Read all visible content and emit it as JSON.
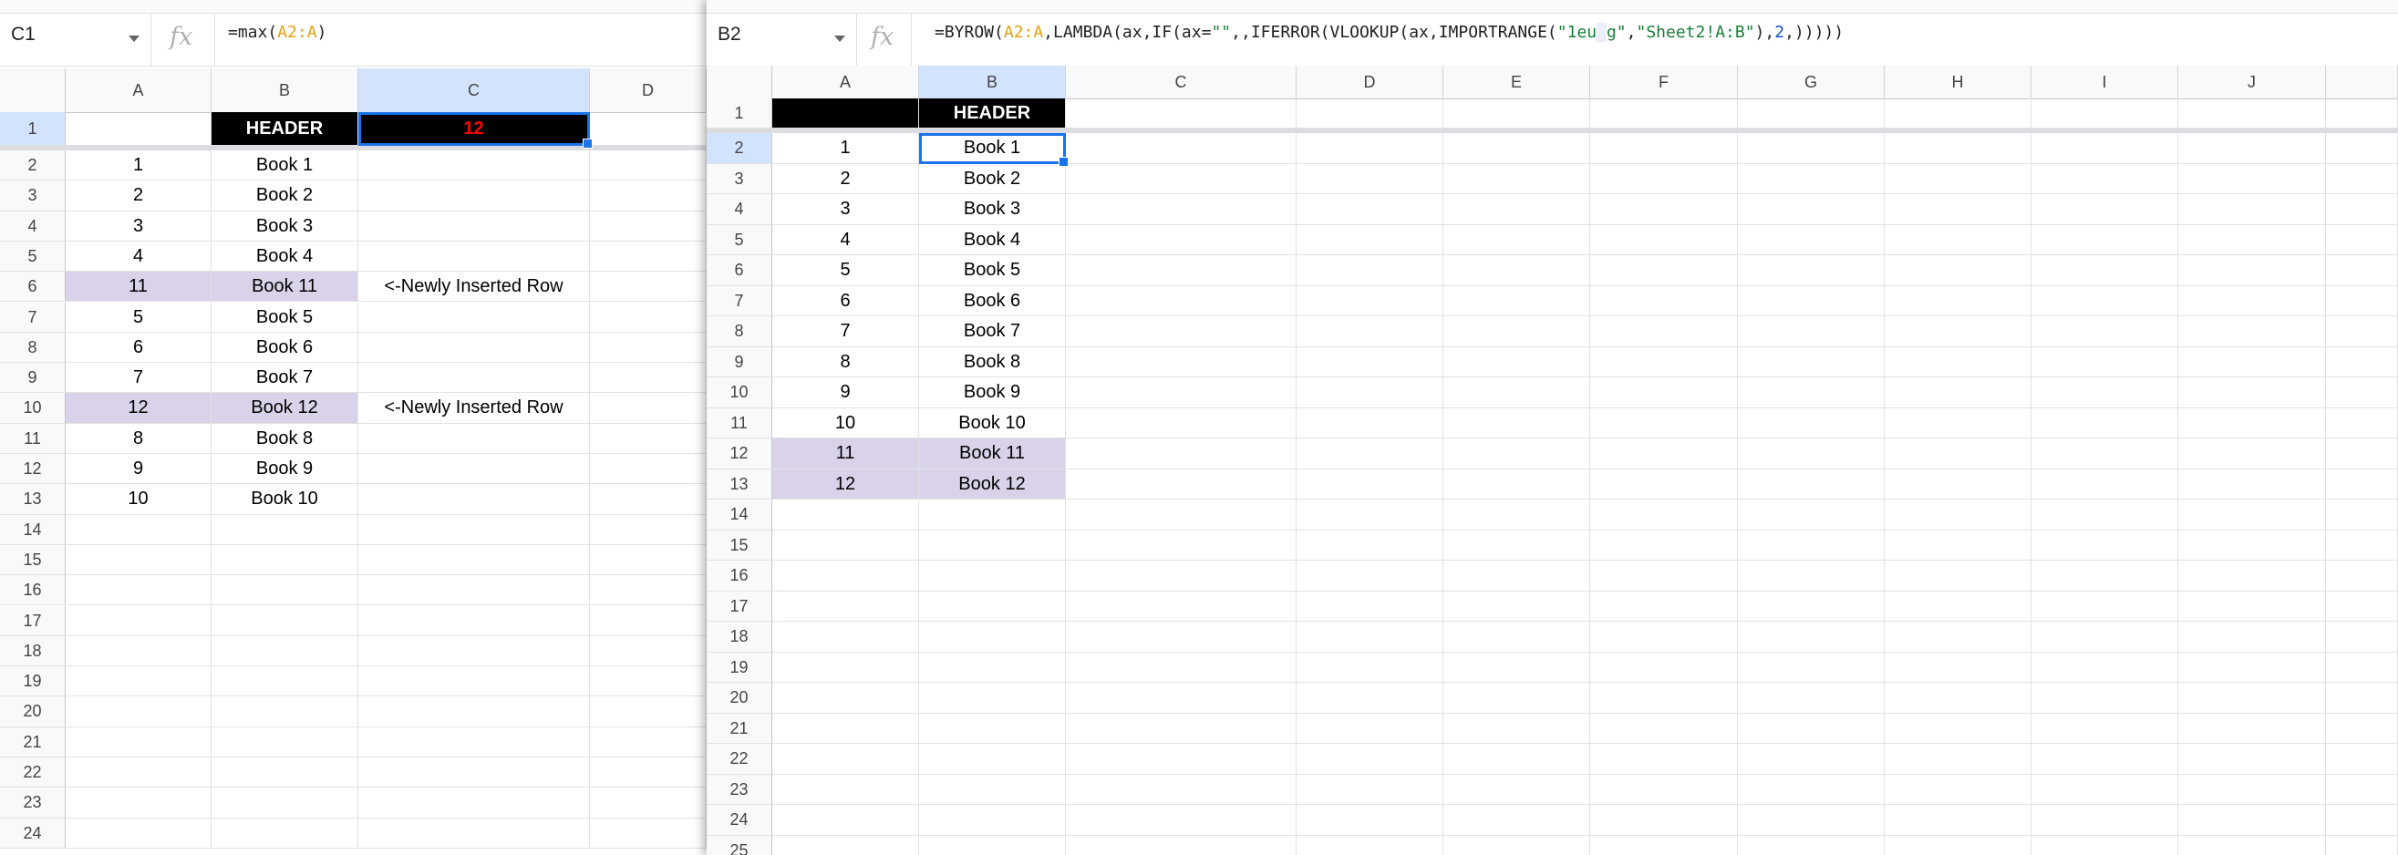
{
  "left_sheet": {
    "name_box": "C1",
    "formula": [
      {
        "t": "=max(",
        "c": "plain"
      },
      {
        "t": "A2:A",
        "c": "orange"
      },
      {
        "t": ")",
        "c": "plain"
      }
    ],
    "columns": [
      "A",
      "B",
      "C",
      "D"
    ],
    "row_numbers": [
      "1",
      "2",
      "3",
      "4",
      "5",
      "6",
      "7",
      "8",
      "9",
      "10",
      "11",
      "12",
      "13",
      "14",
      "15",
      "16",
      "17",
      "18",
      "19",
      "20",
      "21",
      "22",
      "23",
      "24"
    ],
    "header_label": "HEADER",
    "max_value": "12",
    "rows": [
      {
        "a": "1",
        "b": "Book 1",
        "note": "",
        "inserted": false
      },
      {
        "a": "2",
        "b": "Book 2",
        "note": "",
        "inserted": false
      },
      {
        "a": "3",
        "b": "Book 3",
        "note": "",
        "inserted": false
      },
      {
        "a": "4",
        "b": "Book 4",
        "note": "",
        "inserted": false
      },
      {
        "a": "11",
        "b": "Book 11",
        "note": "<-Newly Inserted Row",
        "inserted": true
      },
      {
        "a": "5",
        "b": "Book 5",
        "note": "",
        "inserted": false
      },
      {
        "a": "6",
        "b": "Book 6",
        "note": "",
        "inserted": false
      },
      {
        "a": "7",
        "b": "Book 7",
        "note": "",
        "inserted": false
      },
      {
        "a": "12",
        "b": "Book 12",
        "note": "<-Newly Inserted Row",
        "inserted": true
      },
      {
        "a": "8",
        "b": "Book 8",
        "note": "",
        "inserted": false
      },
      {
        "a": "9",
        "b": "Book 9",
        "note": "",
        "inserted": false
      },
      {
        "a": "10",
        "b": "Book 10",
        "note": "",
        "inserted": false
      }
    ]
  },
  "right_sheet": {
    "name_box": "B2",
    "formula": [
      {
        "t": "=BYROW(",
        "c": "plain"
      },
      {
        "t": "A2:A",
        "c": "orange"
      },
      {
        "t": ",LAMBDA(ax,IF(ax=",
        "c": "plain"
      },
      {
        "t": "\"\"",
        "c": "green"
      },
      {
        "t": ",,IFERROR(VLOOKUP(ax,IMPORTRANGE(",
        "c": "plain"
      },
      {
        "t": "\"1eu",
        "c": "green"
      },
      {
        "t": "                                  ",
        "c": "redact"
      },
      {
        "t": "g\"",
        "c": "green"
      },
      {
        "t": ",",
        "c": "plain"
      },
      {
        "t": "\"Sheet2!A:B\"",
        "c": "green"
      },
      {
        "t": "),",
        "c": "plain"
      },
      {
        "t": "2",
        "c": "blue"
      },
      {
        "t": ",)))))",
        "c": "plain"
      }
    ],
    "columns": [
      "A",
      "B",
      "C",
      "D",
      "E",
      "F",
      "G",
      "H",
      "I",
      "J"
    ],
    "row_numbers": [
      "1",
      "2",
      "3",
      "4",
      "5",
      "6",
      "7",
      "8",
      "9",
      "10",
      "11",
      "12",
      "13",
      "14",
      "15",
      "16",
      "17",
      "18",
      "19",
      "20",
      "21",
      "22",
      "23",
      "24",
      "25"
    ],
    "header_label": "HEADER",
    "rows": [
      {
        "a": "1",
        "b": "Book 1",
        "inserted": false
      },
      {
        "a": "2",
        "b": "Book 2",
        "inserted": false
      },
      {
        "a": "3",
        "b": "Book 3",
        "inserted": false
      },
      {
        "a": "4",
        "b": "Book 4",
        "inserted": false
      },
      {
        "a": "5",
        "b": "Book 5",
        "inserted": false
      },
      {
        "a": "6",
        "b": "Book 6",
        "inserted": false
      },
      {
        "a": "7",
        "b": "Book 7",
        "inserted": false
      },
      {
        "a": "8",
        "b": "Book 8",
        "inserted": false
      },
      {
        "a": "9",
        "b": "Book 9",
        "inserted": false
      },
      {
        "a": "10",
        "b": "Book 10",
        "inserted": false
      },
      {
        "a": "11",
        "b": "Book 11",
        "inserted": true
      },
      {
        "a": "12",
        "b": "Book 12",
        "inserted": true
      }
    ]
  },
  "colors": {
    "header_bg": "#000000",
    "max_text": "#ff0000",
    "inserted_row": "#d9d2e9",
    "selection": "#1a73e8",
    "range_ref": "#e8a010",
    "string_literal": "#188038",
    "number_literal": "#1155cc"
  }
}
